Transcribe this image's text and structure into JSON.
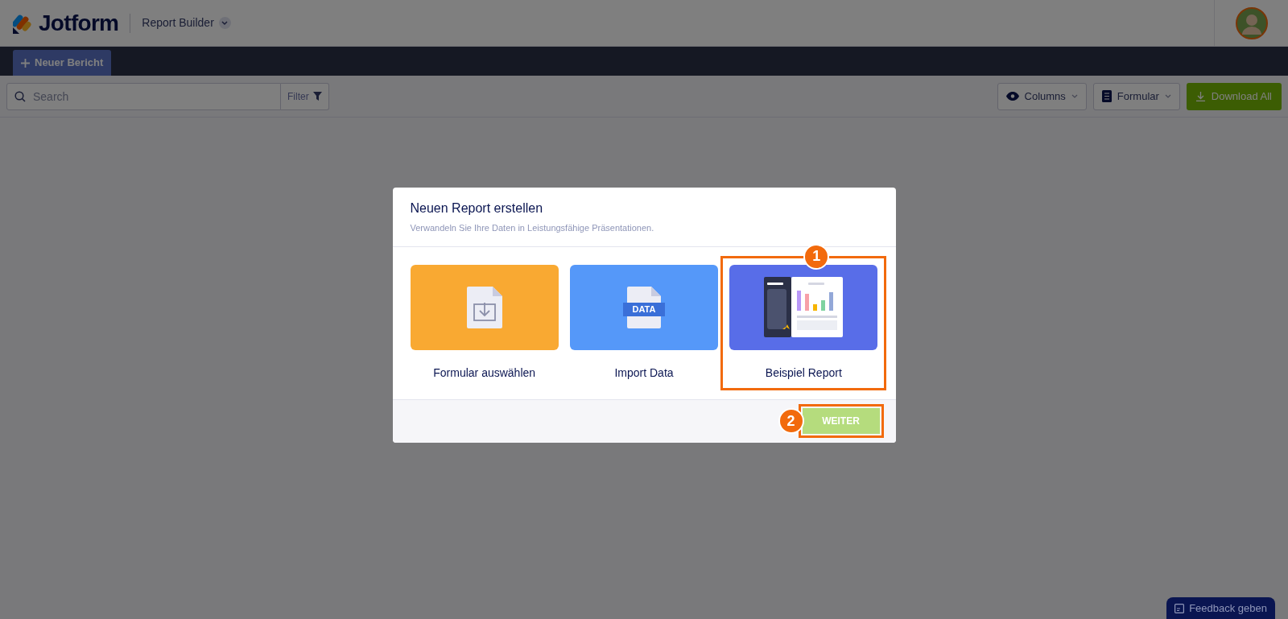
{
  "header": {
    "logo": "Jotform",
    "app_switcher": "Report Builder"
  },
  "nav": {
    "tabs": [
      {
        "label": "Neuer Bericht",
        "selected": true
      }
    ]
  },
  "toolbar": {
    "search": {
      "placeholder": "Search"
    },
    "filter": "Filter",
    "columns": "Columns",
    "form_select": "Formular",
    "download": "Download All"
  },
  "modal": {
    "title": "Neuen Report erstellen",
    "subtitle": "Verwandeln Sie Ihre Daten in Leistungsfähige Präsentationen.",
    "options": [
      {
        "kind": "form",
        "label": "Formular auswählen",
        "selected": false
      },
      {
        "kind": "import",
        "label": "Import Data",
        "badge": "DATA",
        "selected": false
      },
      {
        "kind": "sample",
        "label": "Beispiel Report",
        "selected": true
      }
    ],
    "continue_button": "WEITER"
  },
  "annotations": [
    {
      "label": "1"
    },
    {
      "label": "2"
    }
  ],
  "feedback_button": "Feedback geben"
}
